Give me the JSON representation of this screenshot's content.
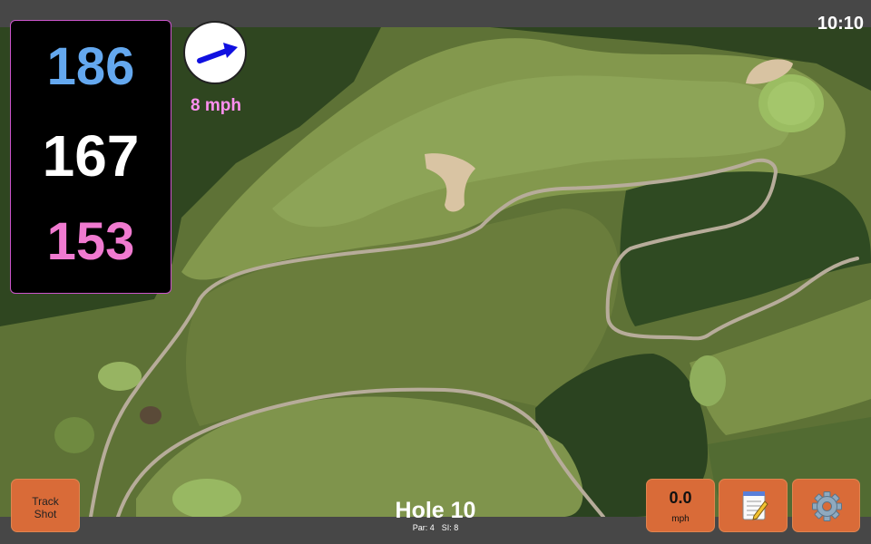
{
  "status_bar": {
    "clock": "10:10"
  },
  "distances": {
    "back": "186",
    "middle": "167",
    "front": "153",
    "colors": {
      "back": "#64a8ef",
      "middle": "#ffffff",
      "front": "#f07ad0"
    }
  },
  "wind": {
    "speed": "8 mph",
    "direction_icon": "wind-direction-arrow-icon",
    "arrow_color": "#1010e0",
    "speed_color": "#ff8ff0"
  },
  "hole": {
    "title": "Hole 10",
    "par": "Par: 4",
    "stroke_index": "SI: 8"
  },
  "buttons": {
    "track_shot": {
      "line1": "Track",
      "line2": "Shot"
    },
    "shot_speed": {
      "value": "0.0",
      "unit": "mph"
    },
    "notes": {
      "icon": "notepad-icon"
    },
    "settings": {
      "icon": "gear-icon"
    },
    "accent": "#d96b38"
  }
}
